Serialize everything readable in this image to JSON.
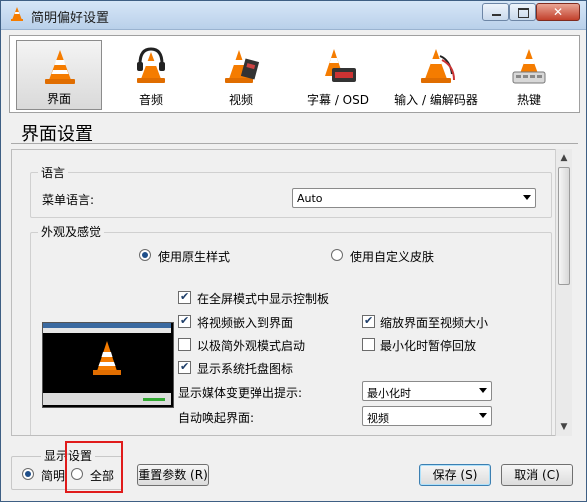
{
  "window": {
    "title": "简明偏好设置"
  },
  "tabs": [
    {
      "label": "界面",
      "active": true
    },
    {
      "label": "音频"
    },
    {
      "label": "视频"
    },
    {
      "label": "字幕 / OSD"
    },
    {
      "label": "输入 / 编解码器"
    },
    {
      "label": "热键"
    }
  ],
  "section_title": "界面设置",
  "language": {
    "group_title": "语言",
    "menu_label": "菜单语言:",
    "menu_value": "Auto"
  },
  "look": {
    "group_title": "外观及感觉",
    "radio_native": "使用原生样式",
    "radio_custom": "使用自定义皮肤",
    "preview_caption": "VLC media player",
    "cb_fullscreen_controls": "在全屏模式中显示控制板",
    "cb_embed_video": "将视频嵌入到界面",
    "cb_resize_interface": "缩放界面至视频大小",
    "cb_minimal_mode": "以极简外观模式启动",
    "cb_pause_minimized": "最小化时暂停回放",
    "cb_systray": "显示系统托盘图标",
    "popup_label": "显示媒体变更弹出提示:",
    "popup_value": "最小化时",
    "raise_label": "自动唤起界面:",
    "raise_value": "视频"
  },
  "footer": {
    "show_settings_label": "显示设置",
    "radio_simple": "简明",
    "radio_all": "全部",
    "reset_button": "重置参数 (R)",
    "save_button": "保存 (S)",
    "cancel_button": "取消 (C)"
  },
  "colors": {
    "cone_orange": "#f57c00",
    "highlight": "#e01b1b",
    "title_gradient_top": "#d6e6f7"
  }
}
